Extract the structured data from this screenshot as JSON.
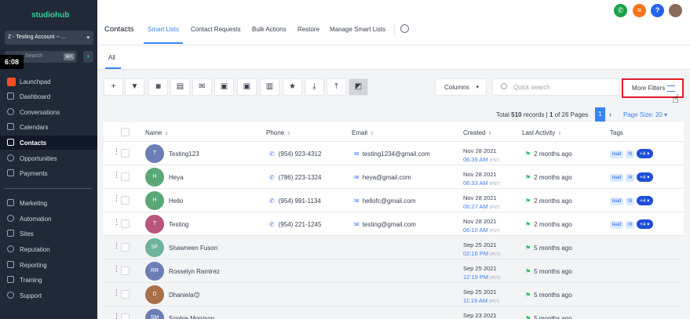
{
  "sidebar": {
    "logo": "studiohub",
    "account": "Z - Testing Account -- ...",
    "search_placeholder": "Search",
    "search_shortcut": "⌘K",
    "timestamp": "6:08",
    "items": [
      {
        "label": "Launchpad",
        "icon": "rocket-icon"
      },
      {
        "label": "Dashboard",
        "icon": "dashboard-icon"
      },
      {
        "label": "Conversations",
        "icon": "chat-icon"
      },
      {
        "label": "Calendars",
        "icon": "calendar-icon"
      },
      {
        "label": "Contacts",
        "icon": "contacts-icon",
        "active": true
      },
      {
        "label": "Opportunities",
        "icon": "opportunities-icon"
      },
      {
        "label": "Payments",
        "icon": "payments-icon"
      },
      {
        "label": "Marketing",
        "icon": "marketing-icon"
      },
      {
        "label": "Automation",
        "icon": "automation-icon"
      },
      {
        "label": "Sites",
        "icon": "sites-icon"
      },
      {
        "label": "Reputation",
        "icon": "star-icon"
      },
      {
        "label": "Reporting",
        "icon": "chart-icon"
      },
      {
        "label": "Training",
        "icon": "training-icon"
      },
      {
        "label": "Support",
        "icon": "support-icon"
      }
    ]
  },
  "header": {
    "title": "Contacts",
    "tabs": [
      "Smart Lists",
      "Contact Requests",
      "Bulk Actions",
      "Restore",
      "Manage Smart Lists"
    ],
    "active_tab": "Smart Lists",
    "top_icons": [
      {
        "name": "phone-icon",
        "glyph": "✆",
        "color": "#16a34a"
      },
      {
        "name": "tasks-icon",
        "glyph": "≡",
        "color": "#f97316"
      },
      {
        "name": "help-icon",
        "glyph": "?",
        "color": "#2563eb"
      }
    ]
  },
  "subtabs": {
    "all": "All"
  },
  "toolbar": {
    "columns_label": "Columns",
    "search_placeholder": "Quick search",
    "more_filters_label": "More Filters"
  },
  "pagination": {
    "prefix": "Total",
    "total": "510",
    "middle": "records |",
    "page": "1",
    "of_pages": "of 26 Pages",
    "current_page": "1",
    "page_size_label": "Page Size: 20"
  },
  "table": {
    "headers": {
      "name": "Name",
      "phone": "Phone",
      "email": "Email",
      "created": "Created",
      "activity": "Last Activity",
      "tags": "Tags"
    },
    "rows": [
      {
        "initials": "T",
        "avatar_color": "#6b7fb5",
        "name": "Testing123",
        "phone": "(954) 923-4312",
        "email": "testing1234@gmail.com",
        "created_date": "Nov 28 2021",
        "created_time": "06:39 AM",
        "tz": "(PST)",
        "activity": "2 months ago",
        "tags": [
          "lead",
          "hl"
        ],
        "more": "+4"
      },
      {
        "initials": "H",
        "avatar_color": "#5aa876",
        "name": "Heya",
        "phone": "(786) 223-1324",
        "email": "heya@gmail.com",
        "created_date": "Nov 28 2021",
        "created_time": "06:33 AM",
        "tz": "(PST)",
        "activity": "2 months ago",
        "tags": [
          "lead",
          "hl"
        ],
        "more": "+4"
      },
      {
        "initials": "H",
        "avatar_color": "#5aa876",
        "name": "Hello",
        "phone": "(954) 991-1134",
        "email": "hellofc@gmail.com",
        "created_date": "Nov 28 2021",
        "created_time": "06:27 AM",
        "tz": "(PST)",
        "activity": "2 months ago",
        "tags": [
          "lead",
          "hl"
        ],
        "more": "+4"
      },
      {
        "initials": "T",
        "avatar_color": "#b8557a",
        "name": "Testing",
        "phone": "(954) 221-1245",
        "email": "testing@gmail.com",
        "created_date": "Nov 28 2021",
        "created_time": "06:10 AM",
        "tz": "(PST)",
        "activity": "2 months ago",
        "tags": [
          "lead",
          "hl"
        ],
        "more": "+4"
      },
      {
        "initials": "SF",
        "avatar_color": "#6fb39a",
        "name": "Shawneen Fuson",
        "phone": "",
        "email": "",
        "created_date": "Sep 25 2021",
        "created_time": "02:16 PM",
        "tz": "(PDT)",
        "activity": "5 months ago",
        "tags": [],
        "more": ""
      },
      {
        "initials": "RR",
        "avatar_color": "#6b7fb5",
        "name": "Rosselyn Ramirez",
        "phone": "",
        "email": "",
        "created_date": "Sep 25 2021",
        "created_time": "12:19 PM",
        "tz": "(PDT)",
        "activity": "5 months ago",
        "tags": [],
        "more": ""
      },
      {
        "initials": "D",
        "avatar_color": "#a86f4a",
        "name": "Dhaniela😊",
        "phone": "",
        "email": "",
        "created_date": "Sep 25 2021",
        "created_time": "11:19 AM",
        "tz": "(PDT)",
        "activity": "5 months ago",
        "tags": [],
        "more": ""
      },
      {
        "initials": "SM",
        "avatar_color": "#6b7fb5",
        "name": "Sophie Morrison",
        "phone": "",
        "email": "",
        "created_date": "Sep 23 2021",
        "created_time": "",
        "tz": "",
        "activity": "5 months ago",
        "tags": [],
        "more": ""
      }
    ]
  }
}
